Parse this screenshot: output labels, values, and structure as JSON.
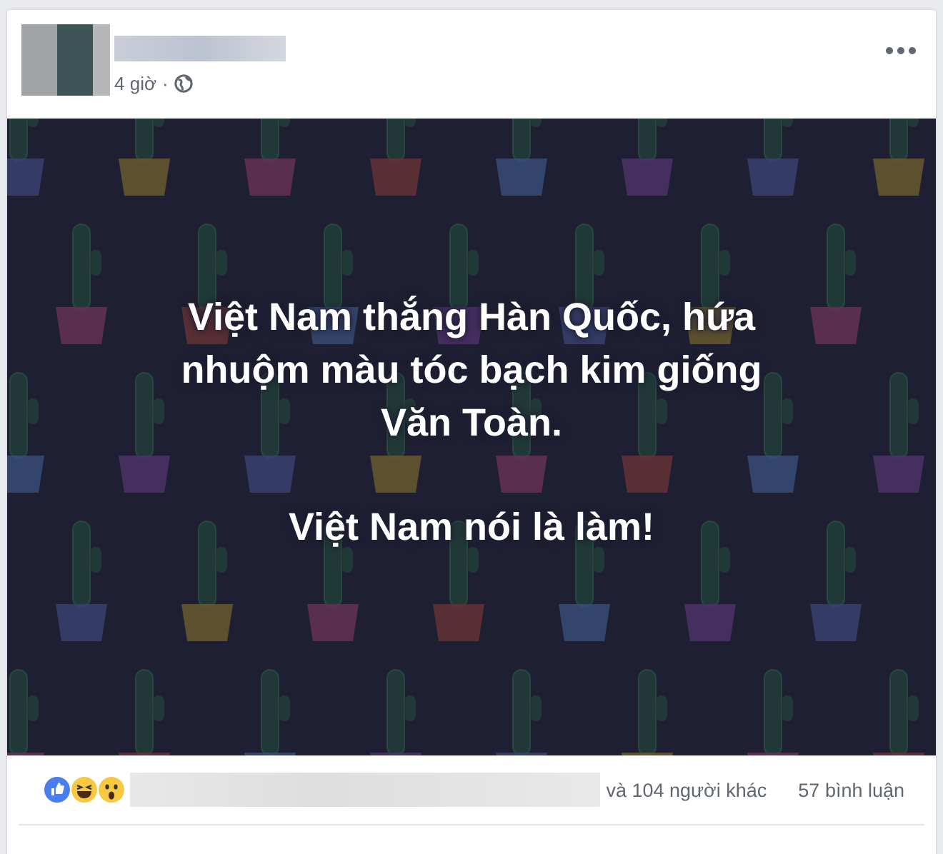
{
  "post": {
    "time": "4 giờ",
    "separator": "·"
  },
  "status": {
    "lines": [
      "Việt Nam thắng Hàn Quốc, hứa",
      "nhuộm màu tóc bạch kim giống",
      "Văn Toàn."
    ],
    "second_line": "Việt Nam nói là làm!"
  },
  "footer": {
    "reactions": [
      {
        "kind": "like"
      },
      {
        "kind": "haha"
      },
      {
        "kind": "wow"
      }
    ],
    "others": "và 104 người khác",
    "comments": "57 bình luận"
  }
}
